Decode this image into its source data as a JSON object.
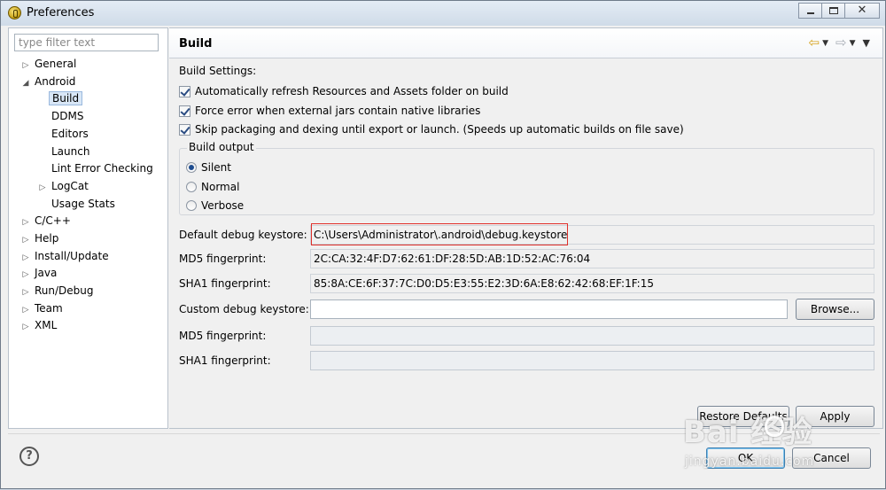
{
  "window": {
    "title": "Preferences",
    "close_glyph": "✕"
  },
  "icons": {
    "app": "eclipse-icon",
    "help": "help-icon",
    "back": "back-arrow-icon",
    "forward": "forward-arrow-icon",
    "menu": "view-menu-icon"
  },
  "sidebar": {
    "filter_placeholder": "type filter text",
    "items": [
      {
        "label": "General",
        "arrow": "▷"
      },
      {
        "label": "Android",
        "arrow": "◢"
      },
      {
        "label": "Build",
        "arrow": ""
      },
      {
        "label": "DDMS",
        "arrow": ""
      },
      {
        "label": "Editors",
        "arrow": ""
      },
      {
        "label": "Launch",
        "arrow": ""
      },
      {
        "label": "Lint Error Checking",
        "arrow": ""
      },
      {
        "label": "LogCat",
        "arrow": "▷"
      },
      {
        "label": "Usage Stats",
        "arrow": ""
      },
      {
        "label": "C/C++",
        "arrow": "▷"
      },
      {
        "label": "Help",
        "arrow": "▷"
      },
      {
        "label": "Install/Update",
        "arrow": "▷"
      },
      {
        "label": "Java",
        "arrow": "▷"
      },
      {
        "label": "Run/Debug",
        "arrow": "▷"
      },
      {
        "label": "Team",
        "arrow": "▷"
      },
      {
        "label": "XML",
        "arrow": "▷"
      }
    ]
  },
  "page": {
    "title": "Build",
    "nav": {
      "back": "⇦",
      "forward": "⇨",
      "dropdown": "▼",
      "menu": "▼"
    },
    "settings_label": "Build Settings:",
    "checkboxes": [
      {
        "label": "Automatically refresh Resources and Assets folder on build",
        "checked": true
      },
      {
        "label": "Force error when external jars contain native libraries",
        "checked": true
      },
      {
        "label": "Skip packaging and dexing until export or launch. (Speeds up automatic builds on file save)",
        "checked": true
      }
    ],
    "build_output": {
      "legend": "Build output",
      "options": [
        {
          "label": "Silent",
          "checked": true
        },
        {
          "label": "Normal",
          "checked": false
        },
        {
          "label": "Verbose",
          "checked": false
        }
      ]
    },
    "default_keystore_label": "Default debug keystore:",
    "default_keystore_value": "C:\\Users\\Administrator\\.android\\debug.keystore",
    "md5_label": "MD5 fingerprint:",
    "md5_value": "2C:CA:32:4F:D7:62:61:DF:28:5D:AB:1D:52:AC:76:04",
    "sha1_label": "SHA1 fingerprint:",
    "sha1_value": "85:8A:CE:6F:37:7C:D0:D5:E3:55:E2:3D:6A:E8:62:42:68:EF:1F:15",
    "custom_keystore_label": "Custom debug keystore:",
    "custom_keystore_value": "",
    "browse_label": "Browse...",
    "custom_md5_label": "MD5 fingerprint:",
    "custom_sha1_label": "SHA1 fingerprint:",
    "restore_defaults_label": "Restore Defaults",
    "apply_label": "Apply"
  },
  "footer": {
    "help_glyph": "?",
    "ok_label": "OK",
    "cancel_label": "Cancel"
  },
  "watermark": {
    "logo": "Bai 经验",
    "url": "jingyan.baidu.com"
  }
}
